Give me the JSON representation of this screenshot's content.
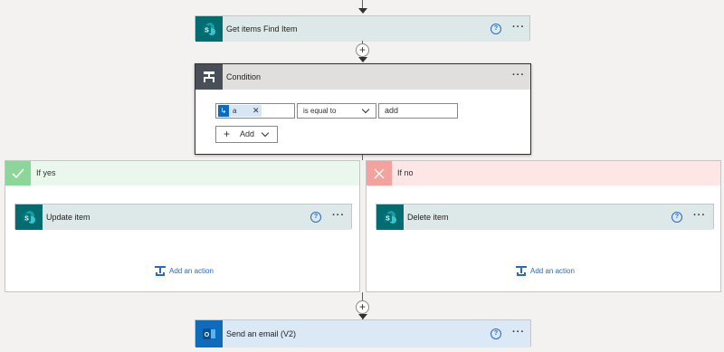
{
  "steps": {
    "get_items": {
      "title": "Get items Find Item"
    },
    "condition": {
      "title": "Condition",
      "token_label": "a",
      "operator": "is equal to",
      "value": "add",
      "add_label": "Add"
    },
    "if_yes": {
      "header": "If yes",
      "action_title": "Update item",
      "add_action_label": "Add an action"
    },
    "if_no": {
      "header": "If no",
      "action_title": "Delete item",
      "add_action_label": "Add an action"
    },
    "send_email": {
      "title": "Send an email (V2)"
    }
  },
  "icons": {
    "more": "ellipsis-icon",
    "help": "help-icon",
    "sharepoint": "sharepoint-icon",
    "condition": "condition-icon",
    "outlook": "outlook-icon"
  },
  "colors": {
    "sharepoint": "#036c70",
    "condition": "#484f58",
    "yes": "#8dd69a",
    "no": "#f4a29e",
    "link": "#2b69c0"
  }
}
